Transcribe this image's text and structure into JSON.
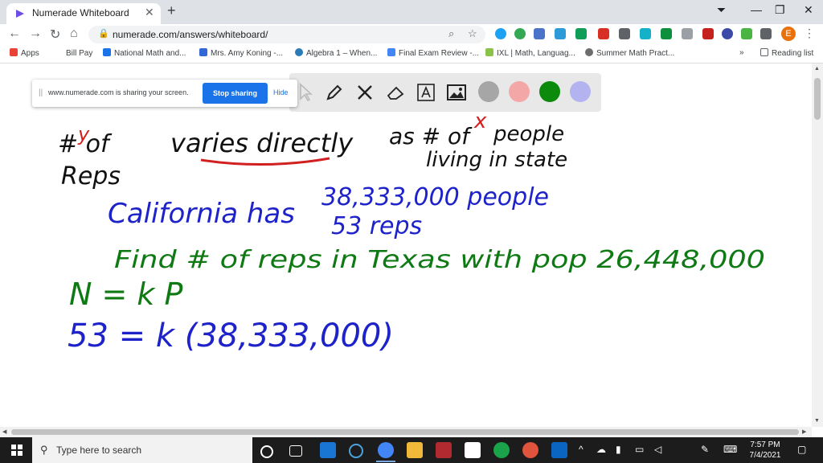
{
  "tab": {
    "title": "Numerade Whiteboard",
    "close": "✕",
    "new_tab": "+"
  },
  "window_controls": {
    "minimize": "—",
    "restore": "❐",
    "close": "✕"
  },
  "omnibox": {
    "url": "numerade.com/answers/whiteboard/"
  },
  "bookmarks": [
    {
      "label": "Apps",
      "color": "#ea4335"
    },
    {
      "label": "Bill Pay",
      "color": "#ffffff"
    },
    {
      "label": "National Math and...",
      "color": "#1a73e8"
    },
    {
      "label": "Mrs. Amy Koning -...",
      "color": "#3367d6"
    },
    {
      "label": "Algebra 1 – When...",
      "color": "#2b7bb9"
    },
    {
      "label": "Final Exam Review -...",
      "color": "#4285f4"
    },
    {
      "label": "IXL | Math, Languag...",
      "color": "#8bc34a"
    },
    {
      "label": "Summer Math Pract...",
      "color": "#6d6d6d"
    }
  ],
  "bookmarks_more": "»",
  "reading_list": "Reading list",
  "share_banner": {
    "message": "www.numerade.com is sharing your screen.",
    "stop_label": "Stop sharing",
    "hide_label": "Hide"
  },
  "palette": [
    "#a6a6a6",
    "#f4a7a7",
    "#0b8a0b",
    "#b3b3f0"
  ],
  "handwriting": {
    "line1_left": "# of",
    "line1_y": "y",
    "line1_reps": "Reps",
    "varies": "varies directly",
    "as": "as # of",
    "x_var": "x",
    "people": "people",
    "living": "living in state",
    "california": "California has",
    "ca_pop": "38,333,000 people",
    "ca_reps": "53 reps",
    "find": "Find # of reps in Texas with pop 26,448,000",
    "eq1": "N = k P",
    "eq2": "53 = k (38,333,000)"
  },
  "ink_colors": {
    "black": "#111111",
    "red": "#d21f1f",
    "blue": "#1d22c9",
    "green": "#0f7a14"
  },
  "taskbar": {
    "search_placeholder": "Type here to search",
    "time": "7:57 PM",
    "date": "7/4/2021"
  }
}
